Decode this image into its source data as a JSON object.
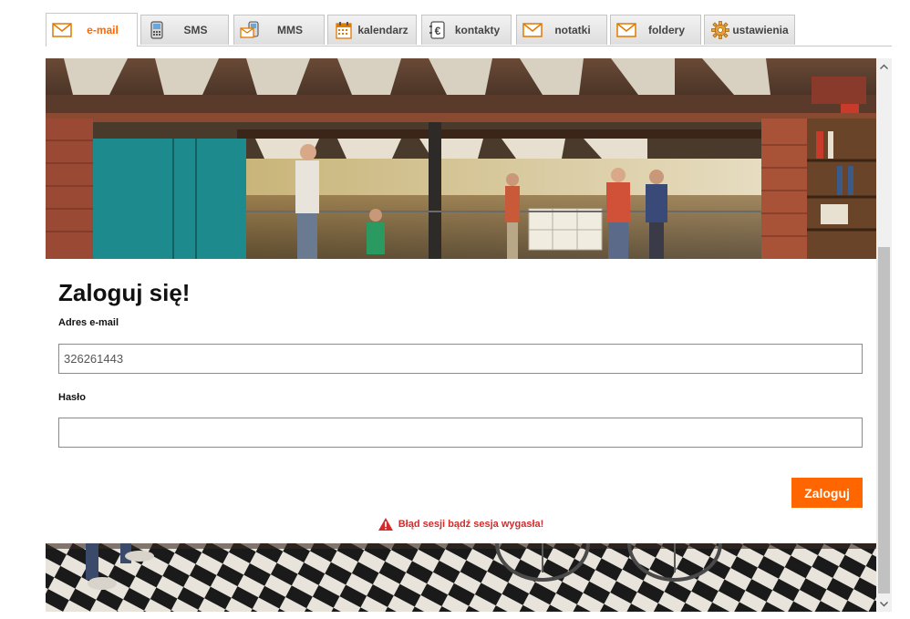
{
  "tabs": [
    {
      "label": "e-mail",
      "icon": "envelope-icon",
      "active": true
    },
    {
      "label": "SMS",
      "icon": "phone-icon",
      "active": false
    },
    {
      "label": "MMS",
      "icon": "mms-icon",
      "active": false
    },
    {
      "label": "kalendarz",
      "icon": "calendar-icon",
      "active": false
    },
    {
      "label": "kontakty",
      "icon": "contacts-icon",
      "active": false
    },
    {
      "label": "notatki",
      "icon": "notes-envelope-icon",
      "active": false
    },
    {
      "label": "foldery",
      "icon": "folder-envelope-icon",
      "active": false
    },
    {
      "label": "ustawienia",
      "icon": "gear-icon",
      "active": false
    }
  ],
  "login": {
    "title": "Zaloguj się!",
    "email_label": "Adres e-mail",
    "email_value": "326261443",
    "password_label": "Hasło",
    "password_value": "",
    "submit_label": "Zaloguj",
    "error_message": "Błąd sesji bądź sesja wygasła!"
  },
  "colors": {
    "accent": "#ff6600",
    "error": "#d42b2b"
  }
}
